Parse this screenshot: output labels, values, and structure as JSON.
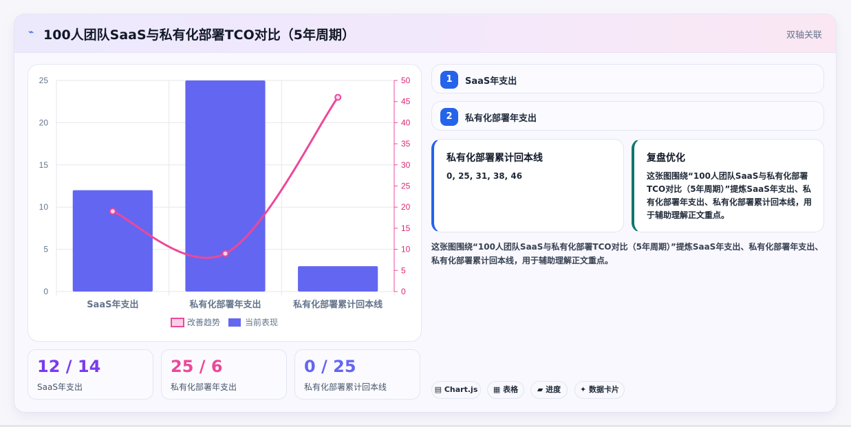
{
  "header": {
    "icon": "trend-icon",
    "title": "100人团队SaaS与私有化部署TCO对比（5年周期）",
    "tag": "双轴关联"
  },
  "chart_data": {
    "type": "bar",
    "categories": [
      "SaaS年支出",
      "私有化部署年支出",
      "私有化部署累计回本线"
    ],
    "series": [
      {
        "name": "当前表现",
        "type": "bar",
        "axis": "left",
        "color": "#6366f1",
        "values": [
          12,
          25,
          3
        ]
      },
      {
        "name": "改善趋势",
        "type": "line",
        "axis": "right",
        "color": "#ec4899",
        "values": [
          19,
          9,
          46
        ]
      }
    ],
    "y_left": {
      "min": 0,
      "max": 25,
      "ticks": [
        0,
        5,
        10,
        15,
        20,
        25
      ]
    },
    "y_right": {
      "min": 0,
      "max": 50,
      "ticks": [
        0,
        5,
        10,
        15,
        20,
        25,
        30,
        35,
        40,
        45,
        50
      ]
    },
    "legend": [
      "改善趋势",
      "当前表现"
    ],
    "legend_position": "bottom",
    "grid": true
  },
  "stats": [
    {
      "value": "12 / 14",
      "label": "SaaS年支出",
      "color": "#7c3aed"
    },
    {
      "value": "25 / 6",
      "label": "私有化部署年支出",
      "color": "#ec4899"
    },
    {
      "value": "0 / 25",
      "label": "私有化部署累计回本线",
      "color": "#6366f1"
    }
  ],
  "steps": [
    {
      "num": "1",
      "label": "SaaS年支出"
    },
    {
      "num": "2",
      "label": "私有化部署年支出"
    }
  ],
  "cards": [
    {
      "title": "私有化部署累计回本线",
      "body": "0, 25, 31, 38, 46",
      "accent": "#2563eb"
    },
    {
      "title": "复盘优化",
      "body": "这张图围绕“100人团队SaaS与私有化部署TCO对比（5年周期）”提炼SaaS年支出、私有化部署年支出、私有化部署累计回本线，用于辅助理解正文重点。",
      "accent": "#0f766e"
    }
  ],
  "description": "这张图围绕“100人团队SaaS与私有化部署TCO对比（5年周期）”提炼SaaS年支出、私有化部署年支出、私有化部署累计回本线，用于辅助理解正文重点。",
  "chips": [
    {
      "icon": "chart-icon",
      "glyph": "▤",
      "label": "Chart.js"
    },
    {
      "icon": "table-icon",
      "glyph": "▦",
      "label": "表格"
    },
    {
      "icon": "progress-icon",
      "glyph": "▰",
      "label": "进度"
    },
    {
      "icon": "sparkle-icon",
      "glyph": "✦",
      "label": "数据卡片"
    }
  ]
}
